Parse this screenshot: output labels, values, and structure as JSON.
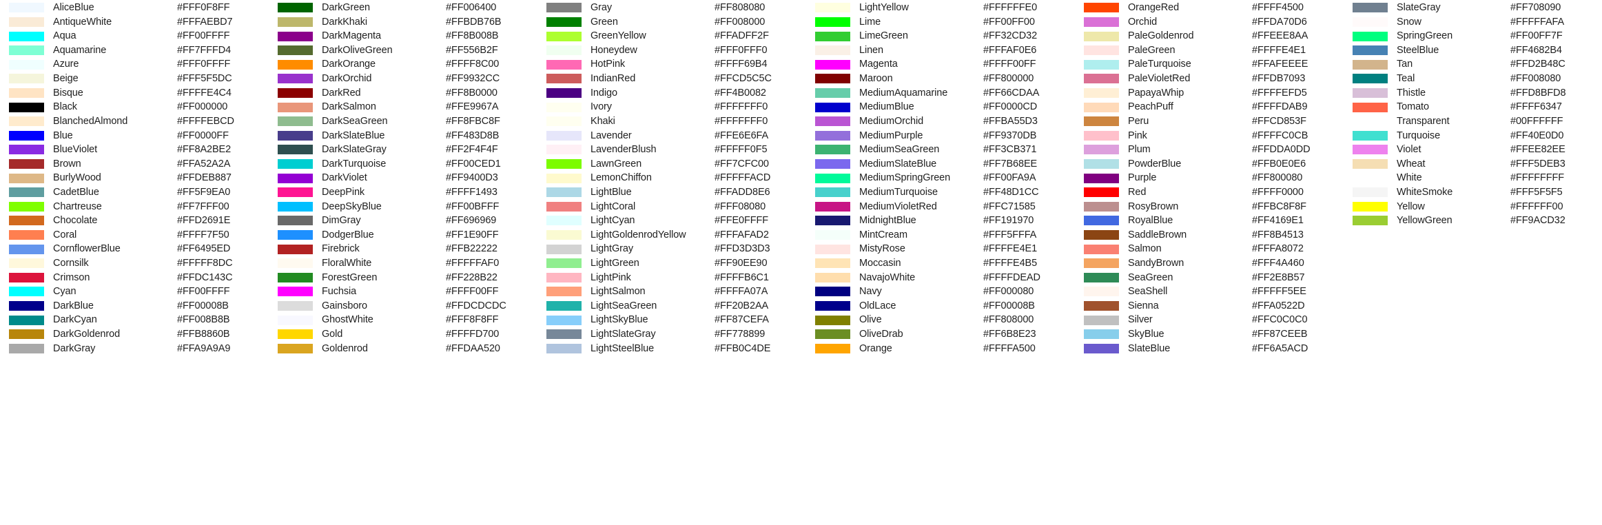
{
  "table": {
    "columns": [
      {
        "rows": [
          {
            "name": "AliceBlue",
            "hex": "#FFF0F8FF",
            "swatch": "#F0F8FF"
          },
          {
            "name": "AntiqueWhite",
            "hex": "#FFFAEBD7",
            "swatch": "#FAEBD7"
          },
          {
            "name": "Aqua",
            "hex": "#FF00FFFF",
            "swatch": "#00FFFF"
          },
          {
            "name": "Aquamarine",
            "hex": "#FF7FFFD4",
            "swatch": "#7FFFD4"
          },
          {
            "name": "Azure",
            "hex": "#FFF0FFFF",
            "swatch": "#F0FFFF"
          },
          {
            "name": "Beige",
            "hex": "#FFF5F5DC",
            "swatch": "#F5F5DC"
          },
          {
            "name": "Bisque",
            "hex": "#FFFFE4C4",
            "swatch": "#FFE4C4"
          },
          {
            "name": "Black",
            "hex": "#FF000000",
            "swatch": "#000000"
          },
          {
            "name": "BlanchedAlmond",
            "hex": "#FFFFEBCD",
            "swatch": "#FFEBCD"
          },
          {
            "name": "Blue",
            "hex": "#FF0000FF",
            "swatch": "#0000FF"
          },
          {
            "name": "BlueViolet",
            "hex": "#FF8A2BE2",
            "swatch": "#8A2BE2"
          },
          {
            "name": "Brown",
            "hex": "#FFA52A2A",
            "swatch": "#A52A2A"
          },
          {
            "name": "BurlyWood",
            "hex": "#FFDEB887",
            "swatch": "#DEB887"
          },
          {
            "name": "CadetBlue",
            "hex": "#FF5F9EA0",
            "swatch": "#5F9EA0"
          },
          {
            "name": "Chartreuse",
            "hex": "#FF7FFF00",
            "swatch": "#7FFF00"
          },
          {
            "name": "Chocolate",
            "hex": "#FFD2691E",
            "swatch": "#D2691E"
          },
          {
            "name": "Coral",
            "hex": "#FFFF7F50",
            "swatch": "#FF7F50"
          },
          {
            "name": "CornflowerBlue",
            "hex": "#FF6495ED",
            "swatch": "#6495ED"
          },
          {
            "name": "Cornsilk",
            "hex": "#FFFFF8DC",
            "swatch": "#FFF8DC"
          },
          {
            "name": "Crimson",
            "hex": "#FFDC143C",
            "swatch": "#DC143C"
          },
          {
            "name": "Cyan",
            "hex": "#FF00FFFF",
            "swatch": "#00FFFF"
          },
          {
            "name": "DarkBlue",
            "hex": "#FF00008B",
            "swatch": "#00008B"
          },
          {
            "name": "DarkCyan",
            "hex": "#FF008B8B",
            "swatch": "#008B8B"
          },
          {
            "name": "DarkGoldenrod",
            "hex": "#FFB8860B",
            "swatch": "#B8860B"
          },
          {
            "name": "DarkGray",
            "hex": "#FFA9A9A9",
            "swatch": "#A9A9A9"
          }
        ]
      },
      {
        "rows": [
          {
            "name": "DarkGreen",
            "hex": "#FF006400",
            "swatch": "#006400"
          },
          {
            "name": "DarkKhaki",
            "hex": "#FFBDB76B",
            "swatch": "#BDB76B"
          },
          {
            "name": "DarkMagenta",
            "hex": "#FF8B008B",
            "swatch": "#8B008B"
          },
          {
            "name": "DarkOliveGreen",
            "hex": "#FF556B2F",
            "swatch": "#556B2F"
          },
          {
            "name": "DarkOrange",
            "hex": "#FFFF8C00",
            "swatch": "#FF8C00"
          },
          {
            "name": "DarkOrchid",
            "hex": "#FF9932CC",
            "swatch": "#9932CC"
          },
          {
            "name": "DarkRed",
            "hex": "#FF8B0000",
            "swatch": "#8B0000"
          },
          {
            "name": "DarkSalmon",
            "hex": "#FFE9967A",
            "swatch": "#E9967A"
          },
          {
            "name": "DarkSeaGreen",
            "hex": "#FF8FBC8F",
            "swatch": "#8FBC8F"
          },
          {
            "name": "DarkSlateBlue",
            "hex": "#FF483D8B",
            "swatch": "#483D8B"
          },
          {
            "name": "DarkSlateGray",
            "hex": "#FF2F4F4F",
            "swatch": "#2F4F4F"
          },
          {
            "name": "DarkTurquoise",
            "hex": "#FF00CED1",
            "swatch": "#00CED1"
          },
          {
            "name": "DarkViolet",
            "hex": "#FF9400D3",
            "swatch": "#9400D3"
          },
          {
            "name": "DeepPink",
            "hex": "#FFFF1493",
            "swatch": "#FF1493"
          },
          {
            "name": "DeepSkyBlue",
            "hex": "#FF00BFFF",
            "swatch": "#00BFFF"
          },
          {
            "name": "DimGray",
            "hex": "#FF696969",
            "swatch": "#696969"
          },
          {
            "name": "DodgerBlue",
            "hex": "#FF1E90FF",
            "swatch": "#1E90FF"
          },
          {
            "name": "Firebrick",
            "hex": "#FFB22222",
            "swatch": "#B22222"
          },
          {
            "name": "FloralWhite",
            "hex": "#FFFFFAF0",
            "swatch": "#FFFAF0"
          },
          {
            "name": "ForestGreen",
            "hex": "#FF228B22",
            "swatch": "#228B22"
          },
          {
            "name": "Fuchsia",
            "hex": "#FFFF00FF",
            "swatch": "#FF00FF"
          },
          {
            "name": "Gainsboro",
            "hex": "#FFDCDCDC",
            "swatch": "#DCDCDC"
          },
          {
            "name": "GhostWhite",
            "hex": "#FFF8F8FF",
            "swatch": "#F8F8FF"
          },
          {
            "name": "Gold",
            "hex": "#FFFFD700",
            "swatch": "#FFD700"
          },
          {
            "name": "Goldenrod",
            "hex": "#FFDAA520",
            "swatch": "#DAA520"
          }
        ]
      },
      {
        "rows": [
          {
            "name": "Gray",
            "hex": "#FF808080",
            "swatch": "#808080"
          },
          {
            "name": "Green",
            "hex": "#FF008000",
            "swatch": "#008000"
          },
          {
            "name": "GreenYellow",
            "hex": "#FFADFF2F",
            "swatch": "#ADFF2F"
          },
          {
            "name": "Honeydew",
            "hex": "#FFF0FFF0",
            "swatch": "#F0FFF0"
          },
          {
            "name": "HotPink",
            "hex": "#FFFF69B4",
            "swatch": "#FF69B4"
          },
          {
            "name": "IndianRed",
            "hex": "#FFCD5C5C",
            "swatch": "#CD5C5C"
          },
          {
            "name": "Indigo",
            "hex": "#FF4B0082",
            "swatch": "#4B0082"
          },
          {
            "name": "Ivory",
            "hex": "#FFFFFFF0",
            "swatch": "#FFFFF0"
          },
          {
            "name": "Khaki",
            "hex": "#FFFFFFF0",
            "swatch": "#FFFFF0"
          },
          {
            "name": "Lavender",
            "hex": "#FFE6E6FA",
            "swatch": "#E6E6FA"
          },
          {
            "name": "LavenderBlush",
            "hex": "#FFFFF0F5",
            "swatch": "#FFF0F5"
          },
          {
            "name": "LawnGreen",
            "hex": "#FF7CFC00",
            "swatch": "#7CFC00"
          },
          {
            "name": "LemonChiffon",
            "hex": "#FFFFFACD",
            "swatch": "#FFFACD"
          },
          {
            "name": "LightBlue",
            "hex": "#FFADD8E6",
            "swatch": "#ADD8E6"
          },
          {
            "name": "LightCoral",
            "hex": "#FFF08080",
            "swatch": "#F08080"
          },
          {
            "name": "LightCyan",
            "hex": "#FFE0FFFF",
            "swatch": "#E0FFFF"
          },
          {
            "name": "LightGoldenrodYellow",
            "hex": "#FFFAFAD2",
            "swatch": "#FAFAD2"
          },
          {
            "name": "LightGray",
            "hex": "#FFD3D3D3",
            "swatch": "#D3D3D3"
          },
          {
            "name": "LightGreen",
            "hex": "#FF90EE90",
            "swatch": "#90EE90"
          },
          {
            "name": "LightPink",
            "hex": "#FFFFB6C1",
            "swatch": "#FFB6C1"
          },
          {
            "name": "LightSalmon",
            "hex": "#FFFFA07A",
            "swatch": "#FFA07A"
          },
          {
            "name": "LightSeaGreen",
            "hex": "#FF20B2AA",
            "swatch": "#20B2AA"
          },
          {
            "name": "LightSkyBlue",
            "hex": "#FF87CEFA",
            "swatch": "#87CEFA"
          },
          {
            "name": "LightSlateGray",
            "hex": "#FF778899",
            "swatch": "#778899"
          },
          {
            "name": "LightSteelBlue",
            "hex": "#FFB0C4DE",
            "swatch": "#B0C4DE"
          }
        ]
      },
      {
        "rows": [
          {
            "name": "LightYellow",
            "hex": "#FFFFFFE0",
            "swatch": "#FFFFE0"
          },
          {
            "name": "Lime",
            "hex": "#FF00FF00",
            "swatch": "#00FF00"
          },
          {
            "name": "LimeGreen",
            "hex": "#FF32CD32",
            "swatch": "#32CD32"
          },
          {
            "name": "Linen",
            "hex": "#FFFAF0E6",
            "swatch": "#FAF0E6"
          },
          {
            "name": "Magenta",
            "hex": "#FFFF00FF",
            "swatch": "#FF00FF"
          },
          {
            "name": "Maroon",
            "hex": "#FF800000",
            "swatch": "#800000"
          },
          {
            "name": "MediumAquamarine",
            "hex": "#FF66CDAA",
            "swatch": "#66CDAA"
          },
          {
            "name": "MediumBlue",
            "hex": "#FF0000CD",
            "swatch": "#0000CD"
          },
          {
            "name": "MediumOrchid",
            "hex": "#FFBA55D3",
            "swatch": "#BA55D3"
          },
          {
            "name": "MediumPurple",
            "hex": "#FF9370DB",
            "swatch": "#9370DB"
          },
          {
            "name": "MediumSeaGreen",
            "hex": "#FF3CB371",
            "swatch": "#3CB371"
          },
          {
            "name": "MediumSlateBlue",
            "hex": "#FF7B68EE",
            "swatch": "#7B68EE"
          },
          {
            "name": "MediumSpringGreen",
            "hex": "#FF00FA9A",
            "swatch": "#00FA9A"
          },
          {
            "name": "MediumTurquoise",
            "hex": "#FF48D1CC",
            "swatch": "#48D1CC"
          },
          {
            "name": "MediumVioletRed",
            "hex": "#FFC71585",
            "swatch": "#C71585"
          },
          {
            "name": "MidnightBlue",
            "hex": "#FF191970",
            "swatch": "#191970"
          },
          {
            "name": "MintCream",
            "hex": "#FFF5FFFA",
            "swatch": "#F5FFFA"
          },
          {
            "name": "MistyRose",
            "hex": "#FFFFE4E1",
            "swatch": "#FFE4E1"
          },
          {
            "name": "Moccasin",
            "hex": "#FFFFE4B5",
            "swatch": "#FFE4B5"
          },
          {
            "name": "NavajoWhite",
            "hex": "#FFFFDEAD",
            "swatch": "#FFDEAD"
          },
          {
            "name": "Navy",
            "hex": "#FF000080",
            "swatch": "#000080"
          },
          {
            "name": "OldLace",
            "hex": "#FF00008B",
            "swatch": "#00008B"
          },
          {
            "name": "Olive",
            "hex": "#FF808000",
            "swatch": "#808000"
          },
          {
            "name": "OliveDrab",
            "hex": "#FF6B8E23",
            "swatch": "#6B8E23"
          },
          {
            "name": "Orange",
            "hex": "#FFFFA500",
            "swatch": "#FFA500"
          }
        ]
      },
      {
        "rows": [
          {
            "name": "OrangeRed",
            "hex": "#FFFF4500",
            "swatch": "#FF4500"
          },
          {
            "name": "Orchid",
            "hex": "#FFDA70D6",
            "swatch": "#DA70D6"
          },
          {
            "name": "PaleGoldenrod",
            "hex": "#FFEEE8AA",
            "swatch": "#EEE8AA"
          },
          {
            "name": "PaleGreen",
            "hex": "#FFFFE4E1",
            "swatch": "#FFE4E1"
          },
          {
            "name": "PaleTurquoise",
            "hex": "#FFAFEEEE",
            "swatch": "#AFEEEE"
          },
          {
            "name": "PaleVioletRed",
            "hex": "#FFDB7093",
            "swatch": "#DB7093"
          },
          {
            "name": "PapayaWhip",
            "hex": "#FFFFEFD5",
            "swatch": "#FFEFD5"
          },
          {
            "name": "PeachPuff",
            "hex": "#FFFFDAB9",
            "swatch": "#FFDAB9"
          },
          {
            "name": "Peru",
            "hex": "#FFCD853F",
            "swatch": "#CD853F"
          },
          {
            "name": "Pink",
            "hex": "#FFFFC0CB",
            "swatch": "#FFC0CB"
          },
          {
            "name": "Plum",
            "hex": "#FFDDA0DD",
            "swatch": "#DDA0DD"
          },
          {
            "name": "PowderBlue",
            "hex": "#FFB0E0E6",
            "swatch": "#B0E0E6"
          },
          {
            "name": "Purple",
            "hex": "#FF800080",
            "swatch": "#800080"
          },
          {
            "name": "Red",
            "hex": "#FFFF0000",
            "swatch": "#FF0000"
          },
          {
            "name": "RosyBrown",
            "hex": "#FFBC8F8F",
            "swatch": "#BC8F8F"
          },
          {
            "name": "RoyalBlue",
            "hex": "#FF4169E1",
            "swatch": "#4169E1"
          },
          {
            "name": "SaddleBrown",
            "hex": "#FF8B4513",
            "swatch": "#8B4513"
          },
          {
            "name": "Salmon",
            "hex": "#FFFA8072",
            "swatch": "#FA8072"
          },
          {
            "name": "SandyBrown",
            "hex": "#FFF4A460",
            "swatch": "#F4A460"
          },
          {
            "name": "SeaGreen",
            "hex": "#FF2E8B57",
            "swatch": "#2E8B57"
          },
          {
            "name": "SeaShell",
            "hex": "#FFFFF5EE",
            "swatch": "#FFF5EE"
          },
          {
            "name": "Sienna",
            "hex": "#FFA0522D",
            "swatch": "#A0522D"
          },
          {
            "name": "Silver",
            "hex": "#FFC0C0C0",
            "swatch": "#C0C0C0"
          },
          {
            "name": "SkyBlue",
            "hex": "#FF87CEEB",
            "swatch": "#87CEEB"
          },
          {
            "name": "SlateBlue",
            "hex": "#FF6A5ACD",
            "swatch": "#6A5ACD"
          }
        ]
      },
      {
        "rows": [
          {
            "name": "SlateGray",
            "hex": "#FF708090",
            "swatch": "#708090"
          },
          {
            "name": "Snow",
            "hex": "#FFFFFAFA",
            "swatch": "#FFFAFA"
          },
          {
            "name": "SpringGreen",
            "hex": "#FF00FF7F",
            "swatch": "#00FF7F"
          },
          {
            "name": "SteelBlue",
            "hex": "#FF4682B4",
            "swatch": "#4682B4"
          },
          {
            "name": "Tan",
            "hex": "#FFD2B48C",
            "swatch": "#D2B48C"
          },
          {
            "name": "Teal",
            "hex": "#FF008080",
            "swatch": "#008080"
          },
          {
            "name": "Thistle",
            "hex": "#FFD8BFD8",
            "swatch": "#D8BFD8"
          },
          {
            "name": "Tomato",
            "hex": "#FFFF6347",
            "swatch": "#FF6347"
          },
          {
            "name": "Transparent",
            "hex": "#00FFFFFF",
            "swatch": "transparent"
          },
          {
            "name": "Turquoise",
            "hex": "#FF40E0D0",
            "swatch": "#40E0D0"
          },
          {
            "name": "Violet",
            "hex": "#FFEE82EE",
            "swatch": "#EE82EE"
          },
          {
            "name": "Wheat",
            "hex": "#FFF5DEB3",
            "swatch": "#F5DEB3"
          },
          {
            "name": "White",
            "hex": "#FFFFFFFF",
            "swatch": "#FFFFFF"
          },
          {
            "name": "WhiteSmoke",
            "hex": "#FFF5F5F5",
            "swatch": "#F5F5F5"
          },
          {
            "name": "Yellow",
            "hex": "#FFFFFF00",
            "swatch": "#FFFF00"
          },
          {
            "name": "YellowGreen",
            "hex": "#FF9ACD32",
            "swatch": "#9ACD32"
          }
        ]
      }
    ]
  }
}
